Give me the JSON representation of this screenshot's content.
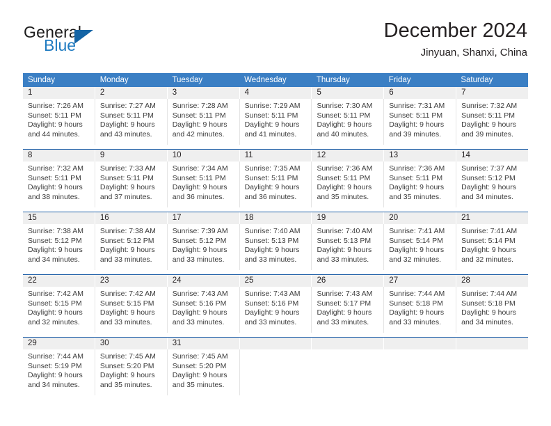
{
  "brand": {
    "word_one": "General",
    "word_two": "Blue",
    "triangle_icon": "blue-triangle-icon"
  },
  "header": {
    "title": "December 2024",
    "subtitle": "Jinyuan, Shanxi, China"
  },
  "calendar": {
    "weekday_labels": [
      "Sunday",
      "Monday",
      "Tuesday",
      "Wednesday",
      "Thursday",
      "Friday",
      "Saturday"
    ],
    "colors": {
      "header_background": "#3b7fc4",
      "header_text": "#ffffff",
      "daynum_band": "#efefef",
      "week_rule": "#1f5fa8",
      "brand_blue": "#1f7bc1",
      "logo_triangle": "#1464a5",
      "body_text": "#3b3b3b"
    },
    "weeks": [
      {
        "days": [
          {
            "num": "1",
            "lines": [
              "Sunrise: 7:26 AM",
              "Sunset: 5:11 PM",
              "Daylight: 9 hours",
              "and 44 minutes."
            ]
          },
          {
            "num": "2",
            "lines": [
              "Sunrise: 7:27 AM",
              "Sunset: 5:11 PM",
              "Daylight: 9 hours",
              "and 43 minutes."
            ]
          },
          {
            "num": "3",
            "lines": [
              "Sunrise: 7:28 AM",
              "Sunset: 5:11 PM",
              "Daylight: 9 hours",
              "and 42 minutes."
            ]
          },
          {
            "num": "4",
            "lines": [
              "Sunrise: 7:29 AM",
              "Sunset: 5:11 PM",
              "Daylight: 9 hours",
              "and 41 minutes."
            ]
          },
          {
            "num": "5",
            "lines": [
              "Sunrise: 7:30 AM",
              "Sunset: 5:11 PM",
              "Daylight: 9 hours",
              "and 40 minutes."
            ]
          },
          {
            "num": "6",
            "lines": [
              "Sunrise: 7:31 AM",
              "Sunset: 5:11 PM",
              "Daylight: 9 hours",
              "and 39 minutes."
            ]
          },
          {
            "num": "7",
            "lines": [
              "Sunrise: 7:32 AM",
              "Sunset: 5:11 PM",
              "Daylight: 9 hours",
              "and 39 minutes."
            ]
          }
        ]
      },
      {
        "days": [
          {
            "num": "8",
            "lines": [
              "Sunrise: 7:32 AM",
              "Sunset: 5:11 PM",
              "Daylight: 9 hours",
              "and 38 minutes."
            ]
          },
          {
            "num": "9",
            "lines": [
              "Sunrise: 7:33 AM",
              "Sunset: 5:11 PM",
              "Daylight: 9 hours",
              "and 37 minutes."
            ]
          },
          {
            "num": "10",
            "lines": [
              "Sunrise: 7:34 AM",
              "Sunset: 5:11 PM",
              "Daylight: 9 hours",
              "and 36 minutes."
            ]
          },
          {
            "num": "11",
            "lines": [
              "Sunrise: 7:35 AM",
              "Sunset: 5:11 PM",
              "Daylight: 9 hours",
              "and 36 minutes."
            ]
          },
          {
            "num": "12",
            "lines": [
              "Sunrise: 7:36 AM",
              "Sunset: 5:11 PM",
              "Daylight: 9 hours",
              "and 35 minutes."
            ]
          },
          {
            "num": "13",
            "lines": [
              "Sunrise: 7:36 AM",
              "Sunset: 5:11 PM",
              "Daylight: 9 hours",
              "and 35 minutes."
            ]
          },
          {
            "num": "14",
            "lines": [
              "Sunrise: 7:37 AM",
              "Sunset: 5:12 PM",
              "Daylight: 9 hours",
              "and 34 minutes."
            ]
          }
        ]
      },
      {
        "days": [
          {
            "num": "15",
            "lines": [
              "Sunrise: 7:38 AM",
              "Sunset: 5:12 PM",
              "Daylight: 9 hours",
              "and 34 minutes."
            ]
          },
          {
            "num": "16",
            "lines": [
              "Sunrise: 7:38 AM",
              "Sunset: 5:12 PM",
              "Daylight: 9 hours",
              "and 33 minutes."
            ]
          },
          {
            "num": "17",
            "lines": [
              "Sunrise: 7:39 AM",
              "Sunset: 5:12 PM",
              "Daylight: 9 hours",
              "and 33 minutes."
            ]
          },
          {
            "num": "18",
            "lines": [
              "Sunrise: 7:40 AM",
              "Sunset: 5:13 PM",
              "Daylight: 9 hours",
              "and 33 minutes."
            ]
          },
          {
            "num": "19",
            "lines": [
              "Sunrise: 7:40 AM",
              "Sunset: 5:13 PM",
              "Daylight: 9 hours",
              "and 33 minutes."
            ]
          },
          {
            "num": "20",
            "lines": [
              "Sunrise: 7:41 AM",
              "Sunset: 5:14 PM",
              "Daylight: 9 hours",
              "and 32 minutes."
            ]
          },
          {
            "num": "21",
            "lines": [
              "Sunrise: 7:41 AM",
              "Sunset: 5:14 PM",
              "Daylight: 9 hours",
              "and 32 minutes."
            ]
          }
        ]
      },
      {
        "days": [
          {
            "num": "22",
            "lines": [
              "Sunrise: 7:42 AM",
              "Sunset: 5:15 PM",
              "Daylight: 9 hours",
              "and 32 minutes."
            ]
          },
          {
            "num": "23",
            "lines": [
              "Sunrise: 7:42 AM",
              "Sunset: 5:15 PM",
              "Daylight: 9 hours",
              "and 33 minutes."
            ]
          },
          {
            "num": "24",
            "lines": [
              "Sunrise: 7:43 AM",
              "Sunset: 5:16 PM",
              "Daylight: 9 hours",
              "and 33 minutes."
            ]
          },
          {
            "num": "25",
            "lines": [
              "Sunrise: 7:43 AM",
              "Sunset: 5:16 PM",
              "Daylight: 9 hours",
              "and 33 minutes."
            ]
          },
          {
            "num": "26",
            "lines": [
              "Sunrise: 7:43 AM",
              "Sunset: 5:17 PM",
              "Daylight: 9 hours",
              "and 33 minutes."
            ]
          },
          {
            "num": "27",
            "lines": [
              "Sunrise: 7:44 AM",
              "Sunset: 5:18 PM",
              "Daylight: 9 hours",
              "and 33 minutes."
            ]
          },
          {
            "num": "28",
            "lines": [
              "Sunrise: 7:44 AM",
              "Sunset: 5:18 PM",
              "Daylight: 9 hours",
              "and 34 minutes."
            ]
          }
        ]
      },
      {
        "days": [
          {
            "num": "29",
            "lines": [
              "Sunrise: 7:44 AM",
              "Sunset: 5:19 PM",
              "Daylight: 9 hours",
              "and 34 minutes."
            ]
          },
          {
            "num": "30",
            "lines": [
              "Sunrise: 7:45 AM",
              "Sunset: 5:20 PM",
              "Daylight: 9 hours",
              "and 35 minutes."
            ]
          },
          {
            "num": "31",
            "lines": [
              "Sunrise: 7:45 AM",
              "Sunset: 5:20 PM",
              "Daylight: 9 hours",
              "and 35 minutes."
            ]
          },
          {
            "num": "",
            "lines": []
          },
          {
            "num": "",
            "lines": []
          },
          {
            "num": "",
            "lines": []
          },
          {
            "num": "",
            "lines": []
          }
        ]
      }
    ]
  }
}
